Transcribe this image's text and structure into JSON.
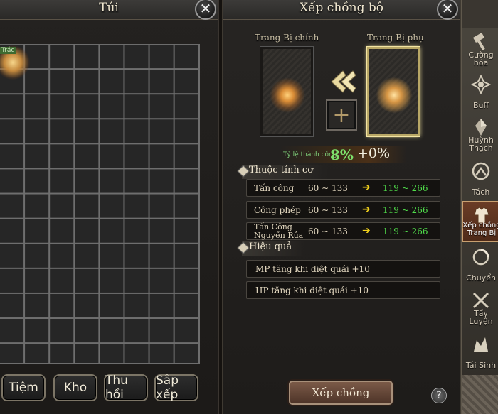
{
  "bag": {
    "title": "Túi",
    "close": "✕",
    "item_tag": "Trác",
    "buttons": {
      "shop": "Tiệm",
      "storage": "Kho",
      "recycle": "Thu hồi",
      "sort": "Sắp xếp"
    }
  },
  "stack": {
    "title": "Xếp chồng bộ",
    "close": "✕",
    "main_label": "Trang Bị chính",
    "sub_label": "Trang Bị phụ",
    "add_symbol": "+",
    "success_label": "Tỷ lệ thành công:",
    "success_rate": "8%",
    "success_bonus": "+0%",
    "attributes_title": "Thuộc tính cơ",
    "attributes": [
      {
        "name": "Tấn công",
        "current": "60 ~ 133",
        "arrow": "➔",
        "next": "119 ~ 266"
      },
      {
        "name": "Công phép",
        "current": "60 ~ 133",
        "arrow": "➔",
        "next": "119 ~ 266"
      },
      {
        "name": "Tấn Công Nguyền Rủa",
        "current": "60 ~ 133",
        "arrow": "➔",
        "next": "119 ~ 266"
      }
    ],
    "effects_title": "Hiệu quả",
    "effects": [
      "MP tăng khi diệt quái +10",
      "HP tăng khi diệt quái +10"
    ],
    "confirm": "Xếp chồng",
    "help": "?"
  },
  "sidebar": {
    "items": [
      {
        "label": "Cường hóa",
        "icon": "hammer-icon"
      },
      {
        "label": "Buff",
        "icon": "buff-icon"
      },
      {
        "label": "Huỳnh Thạch",
        "icon": "crystal-icon"
      },
      {
        "label": "Tách",
        "icon": "split-icon"
      },
      {
        "label": "Xếp chồng Trang Bị",
        "icon": "armor-icon",
        "active": true
      },
      {
        "label": "Chuyển",
        "icon": "transfer-icon"
      },
      {
        "label": "Tẩy Luyện",
        "icon": "refine-icon"
      },
      {
        "label": "Tái Sinh",
        "icon": "rebirth-icon"
      }
    ]
  },
  "colors": {
    "accent_green": "#4fdc4a",
    "arrow_yellow": "#f2d21d",
    "active_tab": "#6a3c26"
  }
}
